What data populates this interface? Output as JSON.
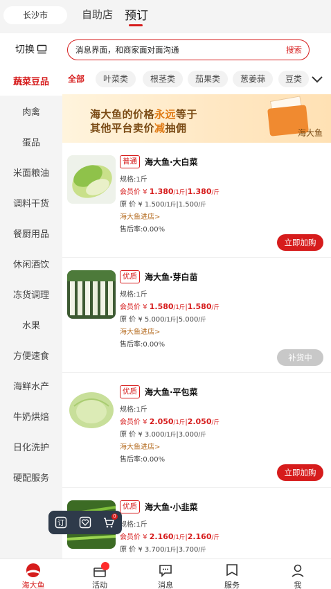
{
  "header": {
    "city": "长沙市",
    "tabs": [
      "自助店",
      "预订"
    ],
    "active_tab": "预订"
  },
  "sidebar": {
    "switch_label": "切换",
    "items": [
      "蔬菜豆品",
      "肉禽",
      "蛋品",
      "米面粮油",
      "调料干货",
      "餐厨用品",
      "休闲酒饮",
      "冻货调理",
      "水果",
      "方便速食",
      "海鲜水产",
      "牛奶烘焙",
      "日化洗护",
      "硬配服务"
    ],
    "active": "蔬菜豆品"
  },
  "search": {
    "placeholder": "消息界面，和商家面对面沟通",
    "button": "搜索"
  },
  "categories": {
    "items": [
      "全部",
      "叶菜类",
      "根茎类",
      "茄果类",
      "葱姜蒜",
      "豆类"
    ],
    "active": "全部"
  },
  "banner": {
    "line1_a": "海大鱼的价格",
    "line1_b": "永远",
    "line1_c": "等于",
    "line2_a": "其他平台卖价",
    "line2_b": "减",
    "line2_c": "抽佣",
    "logo": "海大鱼"
  },
  "products": [
    {
      "badge": "普通",
      "name": "海大鱼·大白菜",
      "spec": "规格:1斤",
      "member_prefix": "会员价 ¥ ",
      "member_price": "1.380",
      "member_unit": "/1斤",
      "member_price2": "1.380",
      "member_unit2": "/斤",
      "orig_prefix": "原    价 ¥ ",
      "orig_price": "1.500",
      "orig_unit": "/1斤",
      "orig_price2": "1.500",
      "orig_unit2": "/斤",
      "store": "海大鱼进店>",
      "rate": "售后率:0.00%",
      "button": "立即加购",
      "available": true
    },
    {
      "badge": "优质",
      "name": "海大鱼·芽白苗",
      "spec": "规格:1斤",
      "member_prefix": "会员价 ¥ ",
      "member_price": "1.580",
      "member_unit": "/1斤",
      "member_price2": "1.580",
      "member_unit2": "/斤",
      "orig_prefix": "原    价 ¥ ",
      "orig_price": "5.000",
      "orig_unit": "/1斤",
      "orig_price2": "5.000",
      "orig_unit2": "/斤",
      "store": "海大鱼进店>",
      "rate": "售后率:0.00%",
      "button": "补货中",
      "available": false
    },
    {
      "badge": "优质",
      "name": "海大鱼·平包菜",
      "spec": "规格:1斤",
      "member_prefix": "会员价 ¥ ",
      "member_price": "2.050",
      "member_unit": "/1斤",
      "member_price2": "2.050",
      "member_unit2": "/斤",
      "orig_prefix": "原    价 ¥ ",
      "orig_price": "3.000",
      "orig_unit": "/1斤",
      "orig_price2": "3.000",
      "orig_unit2": "/斤",
      "store": "海大鱼进店>",
      "rate": "售后率:0.00%",
      "button": "立即加购",
      "available": true
    },
    {
      "badge": "优质",
      "name": "海大鱼·小韭菜",
      "spec": "规格:1斤",
      "member_prefix": "会员价 ¥ ",
      "member_price": "2.160",
      "member_unit": "/1斤",
      "member_price2": "2.160",
      "member_unit2": "/斤",
      "orig_prefix": "原    价 ¥ ",
      "orig_price": "3.700",
      "orig_unit": "/1斤",
      "orig_price2": "3.700",
      "orig_unit2": "/斤",
      "store": "",
      "rate": "",
      "button": "",
      "available": true
    }
  ],
  "float_toolbar": {
    "order_icon_text": "订",
    "cart_count": "0"
  },
  "bottom_nav": {
    "items": [
      "海大鱼",
      "活动",
      "消息",
      "服务",
      "我"
    ],
    "active": "海大鱼"
  },
  "colors": {
    "accent": "#d61c1c",
    "banner_text": "#7a4a14",
    "banner_highlight": "#e07a14",
    "disabled": "#c8c8c8"
  }
}
